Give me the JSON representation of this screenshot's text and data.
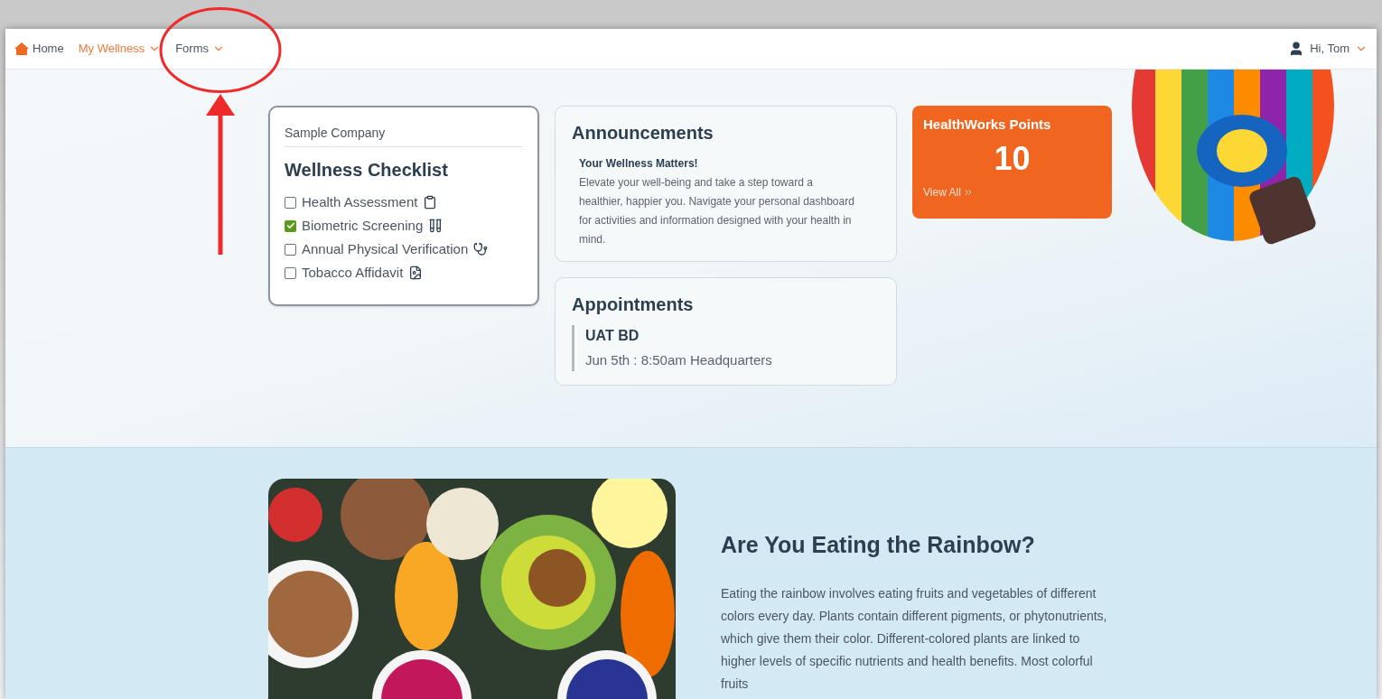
{
  "nav": {
    "items": [
      {
        "label": "Home",
        "selected": false,
        "dropdown": false
      },
      {
        "label": "My Wellness",
        "selected": true,
        "dropdown": true
      },
      {
        "label": "Forms",
        "selected": false,
        "dropdown": true
      }
    ],
    "user": "Hi, Tom"
  },
  "checklist": {
    "company": "Sample Company",
    "title": "Wellness Checklist",
    "items": [
      {
        "label": "Health Assessment",
        "checked": false
      },
      {
        "label": "Biometric Screening",
        "checked": true
      },
      {
        "label": "Annual Physical Verification",
        "checked": false
      },
      {
        "label": "Tobacco Affidavit",
        "checked": false
      }
    ]
  },
  "announcements": {
    "title": "Announcements",
    "headline": "Your Wellness Matters!",
    "body": "Elevate your well-being and take a step toward a healthier, happier you.  Navigate your personal dashboard for activities and information designed with your health in mind."
  },
  "appointments": {
    "title": "Appointments",
    "items": [
      {
        "name": "UAT BD",
        "detail": "Jun 5th : 8:50am Headquarters"
      }
    ]
  },
  "points": {
    "title": "HealthWorks Points",
    "value": "10",
    "link": "View All"
  },
  "feature": {
    "title": "Are You Eating the Rainbow?",
    "body": "Eating the rainbow involves eating fruits and vegetables of different colors every day. Plants contain different pigments, or phytonutrients, which give them their color. Different-colored plants are linked to higher levels of specific nutrients and health benefits. Most colorful fruits"
  }
}
